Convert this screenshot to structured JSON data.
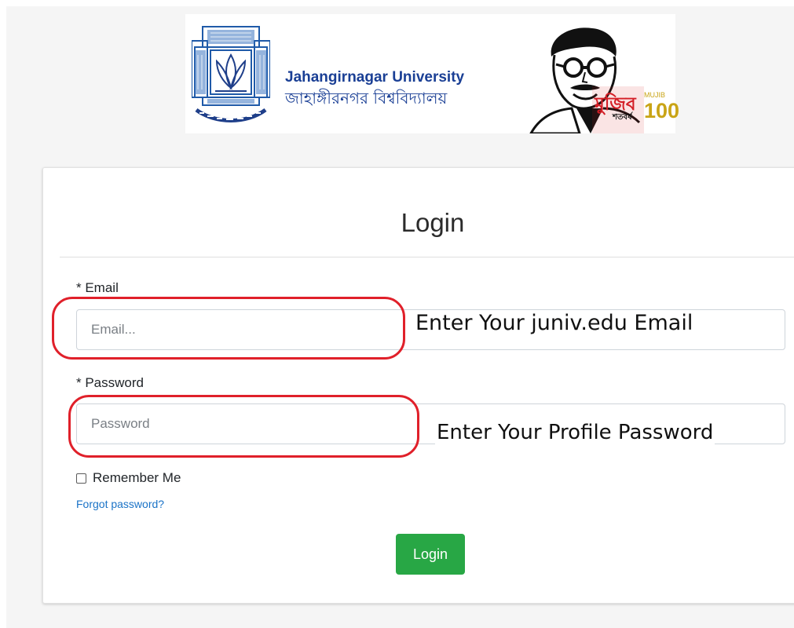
{
  "header": {
    "university_name_en": "Jahangirnagar University",
    "university_name_bn": "জাহাঙ্গীরনগর বিশ্ববিদ্যালয়",
    "logo_icon": "university-seal-icon",
    "campaign_icon": "mujib-portrait-icon",
    "campaign_title_bn": "মুজিব",
    "campaign_title_en": "MUJIB",
    "campaign_number": "100",
    "campaign_subtitle_bn": "শতবর্ষ"
  },
  "login_card": {
    "title": "Login",
    "email": {
      "label": "* Email",
      "placeholder": "Email...",
      "value": ""
    },
    "password": {
      "label": "* Password",
      "placeholder": "Password",
      "value": ""
    },
    "remember_me_label": "Remember Me",
    "remember_me_checked": false,
    "forgot_password_link": "Forgot password?",
    "submit_label": "Login"
  },
  "annotations": {
    "email_hint": "Enter Your juniv.edu Email",
    "password_hint": "Enter Your Profile Password",
    "callout_color": "#e0202a"
  },
  "colors": {
    "brand_blue": "#1a3f95",
    "link_blue": "#1a73c7",
    "button_green": "#28a745",
    "mujib_red": "#d41d25",
    "mujib_gold": "#c9a416"
  }
}
